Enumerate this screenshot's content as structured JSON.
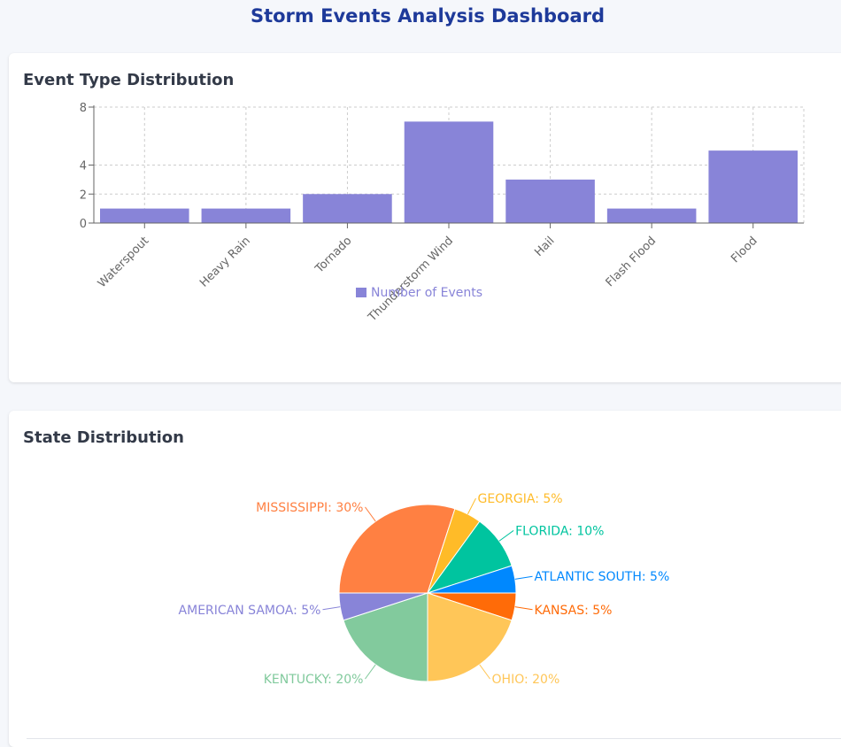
{
  "page": {
    "title": "Storm Events Analysis Dashboard"
  },
  "bar_card": {
    "title": "Event Type Distribution"
  },
  "pie_card": {
    "title": "State Distribution"
  },
  "colors": {
    "bar": "#8884d8",
    "title": "#1e3a9a",
    "axis": "#666666",
    "grid": "#cccccc"
  },
  "chart_data": [
    {
      "type": "bar",
      "title": "Event Type Distribution",
      "categories": [
        "Waterspout",
        "Heavy Rain",
        "Tornado",
        "Thunderstorm Wind",
        "Hail",
        "Flash Flood",
        "Flood"
      ],
      "series": [
        {
          "name": "Number of Events",
          "values": [
            1,
            1,
            2,
            7,
            3,
            1,
            5
          ],
          "color": "#8884d8"
        }
      ],
      "yticks": [
        0,
        2,
        4,
        8
      ],
      "ylim": [
        0,
        8
      ],
      "grid": true,
      "legend": "bottom-center"
    },
    {
      "type": "pie",
      "title": "State Distribution",
      "slices": [
        {
          "label": "MISSISSIPPI",
          "value": 30,
          "color": "#ff8042"
        },
        {
          "label": "GEORGIA",
          "value": 5,
          "color": "#ffbb28"
        },
        {
          "label": "FLORIDA",
          "value": 10,
          "color": "#00c49f"
        },
        {
          "label": "ATLANTIC SOUTH",
          "value": 5,
          "color": "#0088fe"
        },
        {
          "label": "KANSAS",
          "value": 5,
          "color": "#ff6b08"
        },
        {
          "label": "OHIO",
          "value": 20,
          "color": "#ffc658"
        },
        {
          "label": "KENTUCKY",
          "value": 20,
          "color": "#82ca9d"
        },
        {
          "label": "AMERICAN SAMOA",
          "value": 5,
          "color": "#8884d8"
        }
      ]
    }
  ]
}
